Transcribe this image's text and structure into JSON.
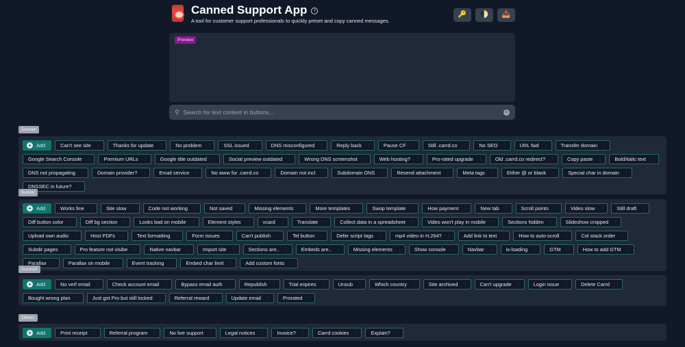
{
  "header": {
    "title": "Canned Support App",
    "subtitle": "A tool for customer support professionals to quickly preset and copy canned messages.",
    "buttons": [
      {
        "icon": "key-icon",
        "glyph": "🔑"
      },
      {
        "icon": "theme-toggle-icon",
        "glyph": "🌓"
      },
      {
        "icon": "inbox-icon",
        "glyph": "📥"
      }
    ]
  },
  "preview": {
    "badge": "Preview"
  },
  "search": {
    "placeholder": "Search for text content in buttons..."
  },
  "add_label": "Add",
  "sections": [
    {
      "label": "Domain",
      "items": [
        "Can't see site",
        "Thanks for update",
        "No problem",
        "SSL issued",
        "DNS misconfigured",
        "Reply back",
        "Pause CF",
        "Still .carrd.co",
        "No SEO",
        "URL fwd",
        "Transfer domain",
        "Google Search Console",
        "Premium URLs",
        "Google title outdated",
        "Social preview outdated",
        "Wrong DNS screenshot",
        "Web hosting?",
        "Pro-rated upgrade",
        "Old .carrd.co redirect?",
        "Copy paste",
        "Bold/italic text",
        "DNS not propagating",
        "Domain provider?",
        "Email service",
        "No www for .carrd.co",
        "Domain not incl",
        "Subdomain DNS",
        "Resend attachment",
        "Meta tags",
        "Either @ or blank",
        "Special char in domain",
        "DNSSEC in future?"
      ]
    },
    {
      "label": "Builder",
      "items": [
        "Works fine",
        "Site slow",
        "Code not working",
        "Not saved",
        "Missing elements",
        "More templates",
        "Swop template",
        "How payment",
        "New tab",
        "Scroll points",
        "Video slow",
        "Still draft",
        "Diff button color",
        "Diff bg section",
        "Looks bad on mobile",
        "Element styles",
        "vcard",
        "Translate",
        "Collect data in a spreadsheet",
        "Video won't play in mobile",
        "Sections hidden",
        "Slideshow cropped",
        "Upload own audio",
        "Host PDFs",
        "Text formatting",
        "Form issues",
        "Can't publish",
        "Tel button",
        "Defer script tags",
        "mp4 video in H.264?",
        "Add link to text",
        "How to auto-scroll",
        "Col stack order",
        "Subdir pages",
        "Pro feature not visibe",
        "Native navbar",
        "Import site",
        "Sections are..",
        "Embeds are..",
        "Missing elements",
        "Show console",
        "Navbar",
        "is-loading",
        "GTM",
        "How to add GTM",
        "Parallax",
        "Parallax on mobile",
        "Event tracking",
        "Embed char limit",
        "Add custom fonts"
      ]
    },
    {
      "label": "Account",
      "items": [
        "No verf email",
        "Check account email",
        "Bypass email auth",
        "Republish",
        "Trial expires",
        "Unsub",
        "Which country",
        "Site archived",
        "Can't upgrade",
        "Login issue",
        "Delete Carrd",
        "Bought wrong plan",
        "Just got Pro but still locked",
        "Referral reward",
        "Update email",
        "Prorated"
      ]
    },
    {
      "label": "Others",
      "items": [
        "Print receipt",
        "Referral program",
        "No live support",
        "Legal notices",
        "Invoice?",
        "Carrd cookies",
        "Explain?"
      ]
    }
  ]
}
